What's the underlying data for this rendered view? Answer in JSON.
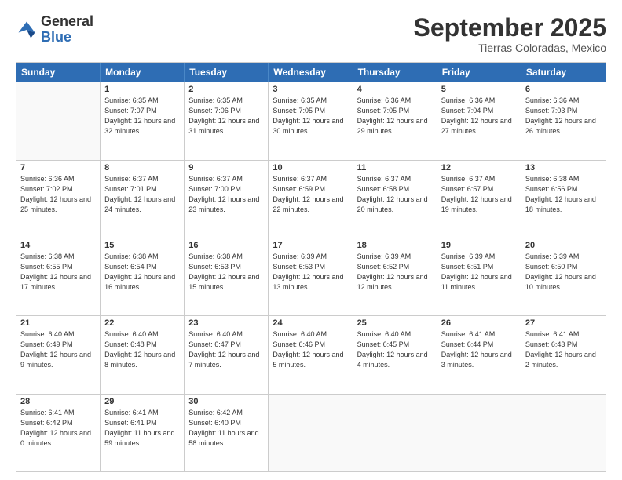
{
  "header": {
    "logo_general": "General",
    "logo_blue": "Blue",
    "month_title": "September 2025",
    "subtitle": "Tierras Coloradas, Mexico"
  },
  "days_of_week": [
    "Sunday",
    "Monday",
    "Tuesday",
    "Wednesday",
    "Thursday",
    "Friday",
    "Saturday"
  ],
  "weeks": [
    [
      {
        "day": "",
        "empty": true
      },
      {
        "day": "1",
        "sunrise": "Sunrise: 6:35 AM",
        "sunset": "Sunset: 7:07 PM",
        "daylight": "Daylight: 12 hours and 32 minutes."
      },
      {
        "day": "2",
        "sunrise": "Sunrise: 6:35 AM",
        "sunset": "Sunset: 7:06 PM",
        "daylight": "Daylight: 12 hours and 31 minutes."
      },
      {
        "day": "3",
        "sunrise": "Sunrise: 6:35 AM",
        "sunset": "Sunset: 7:05 PM",
        "daylight": "Daylight: 12 hours and 30 minutes."
      },
      {
        "day": "4",
        "sunrise": "Sunrise: 6:36 AM",
        "sunset": "Sunset: 7:05 PM",
        "daylight": "Daylight: 12 hours and 29 minutes."
      },
      {
        "day": "5",
        "sunrise": "Sunrise: 6:36 AM",
        "sunset": "Sunset: 7:04 PM",
        "daylight": "Daylight: 12 hours and 27 minutes."
      },
      {
        "day": "6",
        "sunrise": "Sunrise: 6:36 AM",
        "sunset": "Sunset: 7:03 PM",
        "daylight": "Daylight: 12 hours and 26 minutes."
      }
    ],
    [
      {
        "day": "7",
        "sunrise": "Sunrise: 6:36 AM",
        "sunset": "Sunset: 7:02 PM",
        "daylight": "Daylight: 12 hours and 25 minutes."
      },
      {
        "day": "8",
        "sunrise": "Sunrise: 6:37 AM",
        "sunset": "Sunset: 7:01 PM",
        "daylight": "Daylight: 12 hours and 24 minutes."
      },
      {
        "day": "9",
        "sunrise": "Sunrise: 6:37 AM",
        "sunset": "Sunset: 7:00 PM",
        "daylight": "Daylight: 12 hours and 23 minutes."
      },
      {
        "day": "10",
        "sunrise": "Sunrise: 6:37 AM",
        "sunset": "Sunset: 6:59 PM",
        "daylight": "Daylight: 12 hours and 22 minutes."
      },
      {
        "day": "11",
        "sunrise": "Sunrise: 6:37 AM",
        "sunset": "Sunset: 6:58 PM",
        "daylight": "Daylight: 12 hours and 20 minutes."
      },
      {
        "day": "12",
        "sunrise": "Sunrise: 6:37 AM",
        "sunset": "Sunset: 6:57 PM",
        "daylight": "Daylight: 12 hours and 19 minutes."
      },
      {
        "day": "13",
        "sunrise": "Sunrise: 6:38 AM",
        "sunset": "Sunset: 6:56 PM",
        "daylight": "Daylight: 12 hours and 18 minutes."
      }
    ],
    [
      {
        "day": "14",
        "sunrise": "Sunrise: 6:38 AM",
        "sunset": "Sunset: 6:55 PM",
        "daylight": "Daylight: 12 hours and 17 minutes."
      },
      {
        "day": "15",
        "sunrise": "Sunrise: 6:38 AM",
        "sunset": "Sunset: 6:54 PM",
        "daylight": "Daylight: 12 hours and 16 minutes."
      },
      {
        "day": "16",
        "sunrise": "Sunrise: 6:38 AM",
        "sunset": "Sunset: 6:53 PM",
        "daylight": "Daylight: 12 hours and 15 minutes."
      },
      {
        "day": "17",
        "sunrise": "Sunrise: 6:39 AM",
        "sunset": "Sunset: 6:53 PM",
        "daylight": "Daylight: 12 hours and 13 minutes."
      },
      {
        "day": "18",
        "sunrise": "Sunrise: 6:39 AM",
        "sunset": "Sunset: 6:52 PM",
        "daylight": "Daylight: 12 hours and 12 minutes."
      },
      {
        "day": "19",
        "sunrise": "Sunrise: 6:39 AM",
        "sunset": "Sunset: 6:51 PM",
        "daylight": "Daylight: 12 hours and 11 minutes."
      },
      {
        "day": "20",
        "sunrise": "Sunrise: 6:39 AM",
        "sunset": "Sunset: 6:50 PM",
        "daylight": "Daylight: 12 hours and 10 minutes."
      }
    ],
    [
      {
        "day": "21",
        "sunrise": "Sunrise: 6:40 AM",
        "sunset": "Sunset: 6:49 PM",
        "daylight": "Daylight: 12 hours and 9 minutes."
      },
      {
        "day": "22",
        "sunrise": "Sunrise: 6:40 AM",
        "sunset": "Sunset: 6:48 PM",
        "daylight": "Daylight: 12 hours and 8 minutes."
      },
      {
        "day": "23",
        "sunrise": "Sunrise: 6:40 AM",
        "sunset": "Sunset: 6:47 PM",
        "daylight": "Daylight: 12 hours and 7 minutes."
      },
      {
        "day": "24",
        "sunrise": "Sunrise: 6:40 AM",
        "sunset": "Sunset: 6:46 PM",
        "daylight": "Daylight: 12 hours and 5 minutes."
      },
      {
        "day": "25",
        "sunrise": "Sunrise: 6:40 AM",
        "sunset": "Sunset: 6:45 PM",
        "daylight": "Daylight: 12 hours and 4 minutes."
      },
      {
        "day": "26",
        "sunrise": "Sunrise: 6:41 AM",
        "sunset": "Sunset: 6:44 PM",
        "daylight": "Daylight: 12 hours and 3 minutes."
      },
      {
        "day": "27",
        "sunrise": "Sunrise: 6:41 AM",
        "sunset": "Sunset: 6:43 PM",
        "daylight": "Daylight: 12 hours and 2 minutes."
      }
    ],
    [
      {
        "day": "28",
        "sunrise": "Sunrise: 6:41 AM",
        "sunset": "Sunset: 6:42 PM",
        "daylight": "Daylight: 12 hours and 0 minutes."
      },
      {
        "day": "29",
        "sunrise": "Sunrise: 6:41 AM",
        "sunset": "Sunset: 6:41 PM",
        "daylight": "Daylight: 11 hours and 59 minutes."
      },
      {
        "day": "30",
        "sunrise": "Sunrise: 6:42 AM",
        "sunset": "Sunset: 6:40 PM",
        "daylight": "Daylight: 11 hours and 58 minutes."
      },
      {
        "day": "",
        "empty": true
      },
      {
        "day": "",
        "empty": true
      },
      {
        "day": "",
        "empty": true
      },
      {
        "day": "",
        "empty": true
      }
    ]
  ]
}
